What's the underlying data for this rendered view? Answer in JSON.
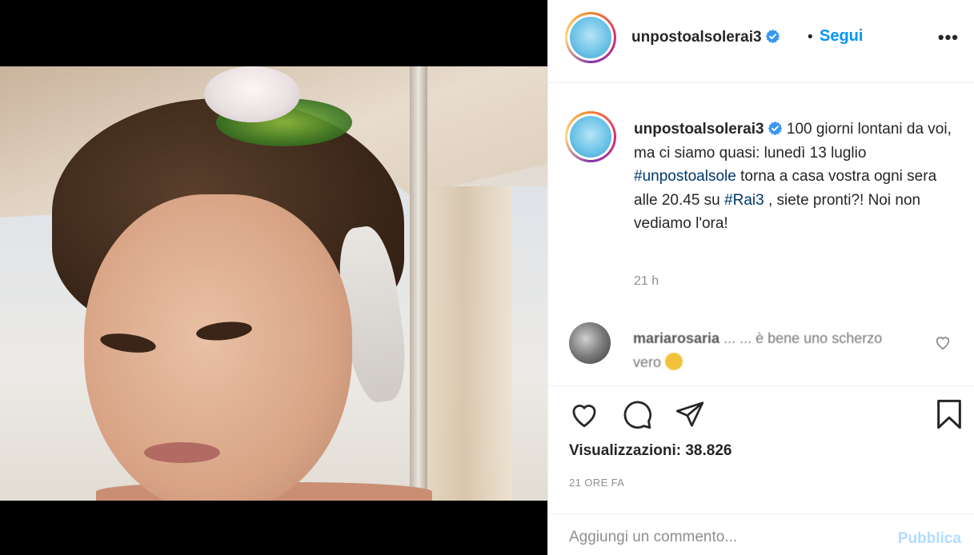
{
  "post": {
    "username": "unpostoalsolerai3",
    "verified_icon": "verified-badge-icon",
    "separator": "•",
    "follow_label": "Segui",
    "more_label": "•••",
    "avatar_text": "UN POSTO AL SOLE"
  },
  "caption": {
    "username": "unpostoalsolerai3",
    "text_1": "100 giorni lontani da voi, ma ci siamo quasi: lunedì 13 luglio ",
    "hashtag_1": "#unpostoalsole",
    "text_2": " torna a casa vostra ogni sera alle 20.45 su ",
    "hashtag_2": "#Rai3",
    "text_3": " , siete pronti?! Noi non vediamo l'ora!",
    "time": "21 h"
  },
  "comment": {
    "username": "mariarosaria",
    "text": "... ... è bene uno scherzo vero",
    "like_icon": "heart-outline-icon"
  },
  "actions": {
    "like_icon": "heart-outline-icon",
    "comment_icon": "speech-bubble-icon",
    "share_icon": "paper-plane-icon",
    "save_icon": "bookmark-icon",
    "views_label": "Visualizzazioni: 38.826",
    "posted_ago": "21 ORE FA"
  },
  "add_comment": {
    "placeholder": "Aggiungi un commento...",
    "publish_label": "Pubblica"
  },
  "colors": {
    "link_blue": "#0095f6",
    "hashtag_blue": "#00376b",
    "muted": "#8e8e8e",
    "publish_disabled": "#b3dbff"
  }
}
